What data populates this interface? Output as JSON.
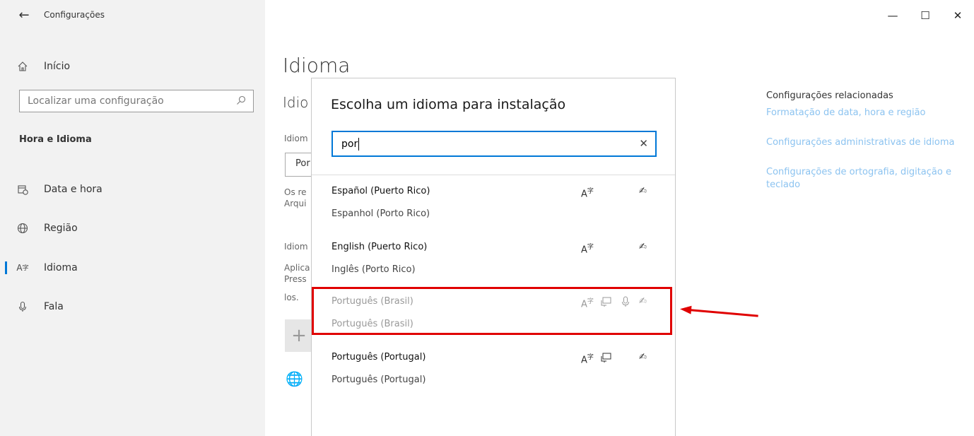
{
  "app": {
    "back_icon": "←",
    "title": "Configurações"
  },
  "window_controls": {
    "minimize": "—",
    "maximize": "☐",
    "close": "✕"
  },
  "sidebar": {
    "home_label": "Início",
    "search_placeholder": "Localizar uma configuração",
    "section": "Hora e Idioma",
    "items": [
      {
        "label": "Data e hora",
        "icon": "calendar-clock-icon"
      },
      {
        "label": "Região",
        "icon": "globe-icon"
      },
      {
        "label": "Idioma",
        "icon": "language-icon",
        "active": true
      },
      {
        "label": "Fala",
        "icon": "microphone-icon"
      }
    ]
  },
  "page": {
    "title": "Idioma",
    "sub_heading": "Idio",
    "line1": "Idiom",
    "select_value": "Por",
    "line2a": "Os re",
    "line2b": "Arqui",
    "line3": "Idiom",
    "line4a": "Aplica",
    "line4b": "Press",
    "line4c": "los."
  },
  "related": {
    "title": "Configurações relacionadas",
    "links": [
      "Formatação de data, hora e região",
      "Configurações administrativas de idioma",
      "Configurações de ortografia, digitação e teclado"
    ],
    "link_color": "#8cc3f0"
  },
  "dialog": {
    "title": "Escolha um idioma para instalação",
    "search_value": "por",
    "clear_icon": "✕",
    "languages": [
      {
        "name": "Español (Puerto Rico)",
        "local": "Espanhol (Porto Rico)",
        "features": [
          "display-language-icon",
          "handwriting-icon"
        ]
      },
      {
        "name": "English (Puerto Rico)",
        "local": "Inglês (Porto Rico)",
        "features": [
          "display-language-icon",
          "handwriting-icon"
        ]
      },
      {
        "name": "Português (Brasil)",
        "local": "Português (Brasil)",
        "disabled": true,
        "features": [
          "display-language-icon",
          "text-to-speech-icon",
          "speech-recognition-icon",
          "handwriting-icon"
        ]
      },
      {
        "name": "Português (Portugal)",
        "local": "Português (Portugal)",
        "features": [
          "display-language-icon",
          "text-to-speech-icon",
          "handwriting-icon"
        ]
      }
    ]
  },
  "annotation": {
    "color": "#e00000"
  }
}
